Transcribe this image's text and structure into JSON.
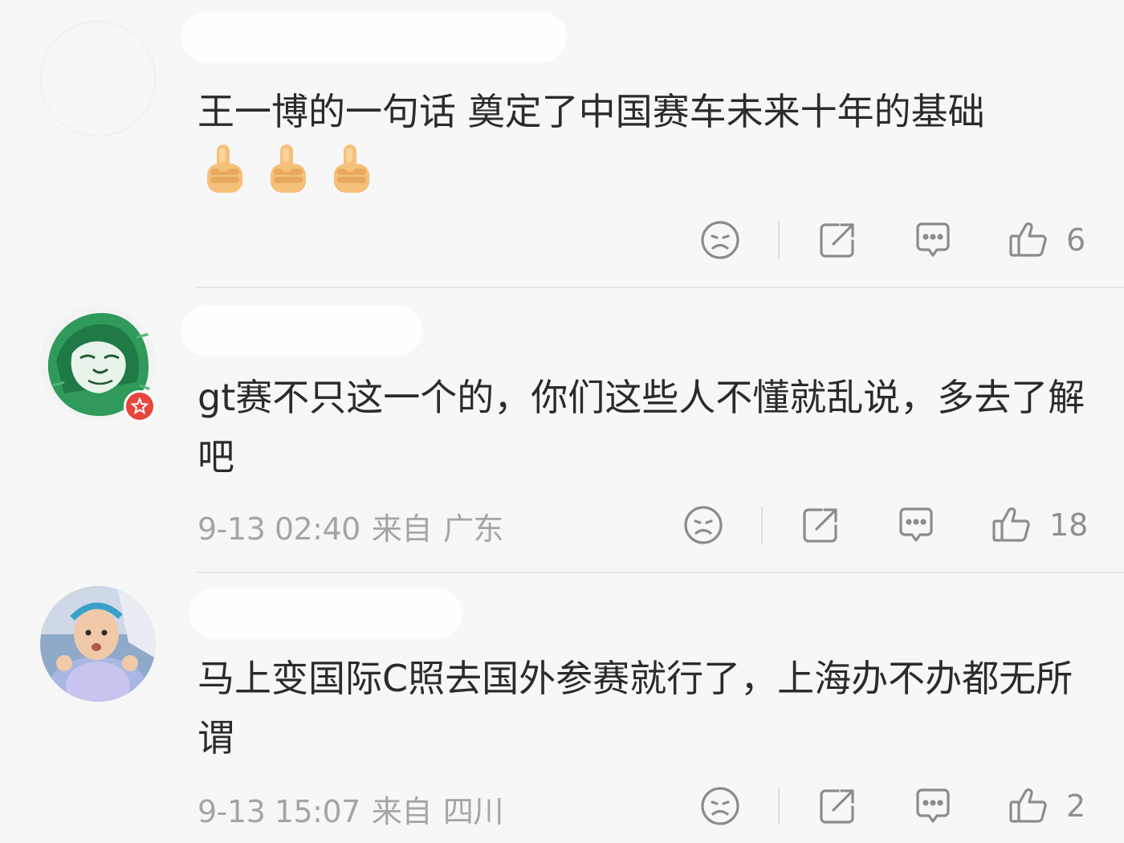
{
  "comments": [
    {
      "text": "王一博的一句话 奠定了中国赛车未来十年的基础",
      "emoji": [
        "thumbs-up",
        "thumbs-up",
        "thumbs-up"
      ],
      "likes": "6"
    },
    {
      "text": "gt赛不只这一个的，你们这些人不懂就乱说，多去了解吧",
      "date": "9-13 02:40",
      "from": "来自",
      "location": "广东",
      "likes": "18",
      "avatar": "lion-avatar"
    },
    {
      "text": "马上变国际C照去国外参赛就行了，上海办不办都无所谓",
      "date": "9-13 15:07",
      "from": "来自",
      "location": "四川",
      "likes": "2",
      "avatar": "baby-photo-avatar"
    }
  ],
  "icons": [
    "dislike-face-icon",
    "share-icon",
    "reply-comment-icon",
    "like-thumb-icon"
  ],
  "colors": {
    "accent_badge": "#e8453c",
    "text": "#2b2b2b",
    "meta": "#a5a5a5"
  }
}
